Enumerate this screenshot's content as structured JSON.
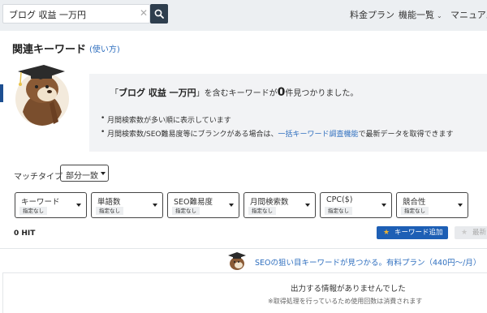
{
  "search": {
    "value": "ブログ 収益 一万円",
    "clear_icon": "close-icon",
    "button_icon": "search-icon"
  },
  "nav": {
    "pricing": "料金プラン",
    "features": "機能一覧",
    "manual": "マニュアル"
  },
  "section": {
    "title": "関連キーワード",
    "help_link": "(使い方)"
  },
  "result_info": {
    "prefix": "「",
    "keyword": "ブログ 収益 一万円",
    "middle": "」を含むキーワードが",
    "count": "0",
    "suffix": "件見つかりました。",
    "bullet1": "月間検索数が多い順に表示しています",
    "bullet2_before": "月間検索数/SEO難易度等にブランクがある場合は、",
    "bullet2_link": "一括キーワード調査機能",
    "bullet2_after": "で最新データを取得できます"
  },
  "match": {
    "label": "マッチタイプ",
    "selected": "部分一致"
  },
  "filters": [
    {
      "label": "キーワード",
      "chip": "指定なし"
    },
    {
      "label": "単語数",
      "chip": "指定なし"
    },
    {
      "label": "SEO難易度",
      "chip": "指定なし"
    },
    {
      "label": "月間検索数",
      "chip": "指定なし"
    },
    {
      "label": "CPC($)",
      "chip": "指定なし"
    },
    {
      "label": "競合性",
      "chip": "指定なし"
    }
  ],
  "results": {
    "hit_count": "0 HIT",
    "add_keyword_label": "キーワード追加",
    "download_label": "最新"
  },
  "promo": {
    "text": "SEOの狙い目キーワードが見つかる。有料プラン（440円〜/月）"
  },
  "empty": {
    "line1": "出力する情報がありませんでした",
    "line2": "※取得処理を行っているため使用回数は消費されます"
  },
  "colors": {
    "accent": "#1d5fb5",
    "link": "#2f6fbf",
    "search_button": "#2e3e4e",
    "star": "#f2b530"
  }
}
